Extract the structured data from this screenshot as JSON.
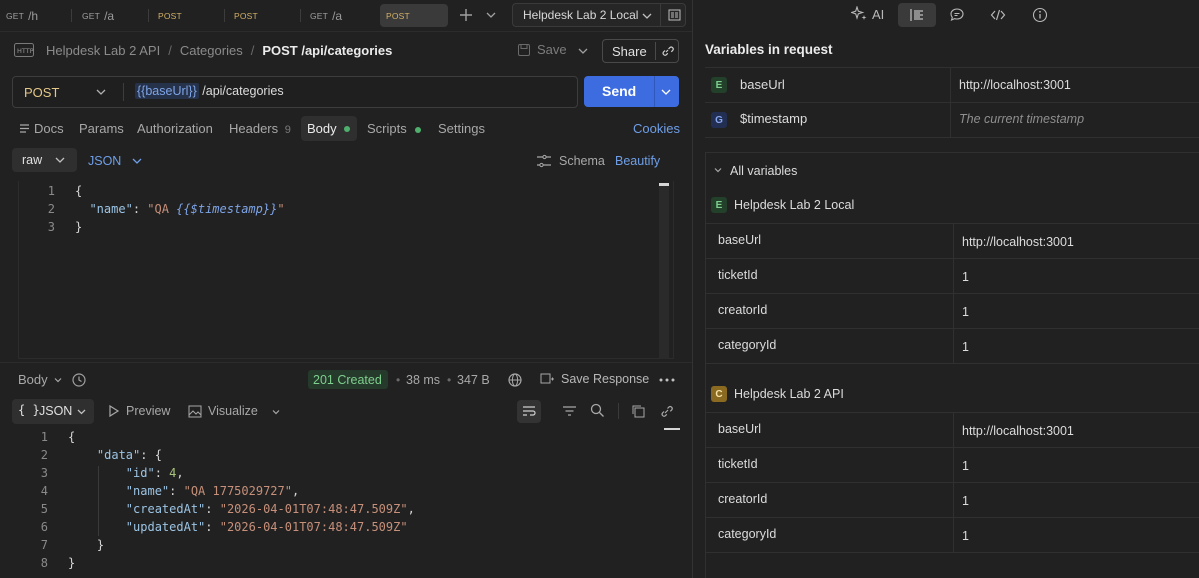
{
  "tabs": [
    {
      "method": "GET",
      "label": "GET /h"
    },
    {
      "method": "GET",
      "label": "GET /a"
    },
    {
      "method": "POST",
      "label": "POST"
    },
    {
      "method": "POST",
      "label": "POST"
    },
    {
      "method": "GET",
      "label": "GET /a"
    },
    {
      "method": "POST",
      "label": "POST"
    }
  ],
  "environment": "Helpdesk Lab 2 Local",
  "breadcrumb": {
    "collection": "Helpdesk Lab 2 API",
    "sep": "/",
    "folder": "Categories",
    "request": "POST /api/categories"
  },
  "save_label": "Save",
  "share_label": "Share",
  "request": {
    "method": "POST",
    "url_var": "{{baseUrl}}",
    "url_path": "/api/categories",
    "send_label": "Send"
  },
  "req_tabs": {
    "docs": "Docs",
    "params": "Params",
    "authorization": "Authorization",
    "headers": "Headers",
    "headers_count": "9",
    "body": "Body",
    "scripts": "Scripts",
    "settings": "Settings",
    "cookies": "Cookies"
  },
  "body_opts": {
    "mode": "raw",
    "lang": "JSON",
    "schema": "Schema",
    "beautify": "Beautify"
  },
  "req_body": {
    "line_numbers": [
      "1",
      "2",
      "3"
    ],
    "l1": "{",
    "l2_key": "\"name\"",
    "l2_colon": ": ",
    "l2_open": "\"QA ",
    "l2_var": "{{$timestamp}}",
    "l2_close": "\"",
    "l3": "}"
  },
  "response_bar": {
    "body": "Body",
    "status": "201 Created",
    "time": "38 ms",
    "size": "347 B",
    "save_response": "Save Response"
  },
  "response_opts": {
    "format": "JSON",
    "preview": "Preview",
    "visualize": "Visualize"
  },
  "resp_body": {
    "line_numbers": [
      "1",
      "2",
      "3",
      "4",
      "5",
      "6",
      "7",
      "8"
    ],
    "data_key": "\"data\"",
    "id_key": "\"id\"",
    "id_val": "4",
    "name_key": "\"name\"",
    "name_val": "\"QA 1775029727\"",
    "created_key": "\"createdAt\"",
    "created_val": "\"2026-04-01T07:48:47.509Z\"",
    "updated_key": "\"updatedAt\"",
    "updated_val": "\"2026-04-01T07:48:47.509Z\""
  },
  "right_panel": {
    "ai_label": "AI",
    "title": "Variables in request",
    "request_vars": [
      {
        "badge": "E",
        "name": "baseUrl",
        "value": "http://localhost:3001"
      },
      {
        "badge": "G",
        "name": "$timestamp",
        "value": "The current timestamp"
      }
    ],
    "all_variables": "All variables",
    "env_group": {
      "badge": "E",
      "name": "Helpdesk Lab 2 Local",
      "rows": [
        {
          "name": "baseUrl",
          "value": "http://localhost:3001"
        },
        {
          "name": "ticketId",
          "value": "1"
        },
        {
          "name": "creatorId",
          "value": "1"
        },
        {
          "name": "categoryId",
          "value": "1"
        }
      ]
    },
    "coll_group": {
      "badge": "C",
      "name": "Helpdesk Lab 2 API",
      "rows": [
        {
          "name": "baseUrl",
          "value": "http://localhost:3001"
        },
        {
          "name": "ticketId",
          "value": "1"
        },
        {
          "name": "creatorId",
          "value": "1"
        },
        {
          "name": "categoryId",
          "value": "1"
        }
      ]
    }
  }
}
